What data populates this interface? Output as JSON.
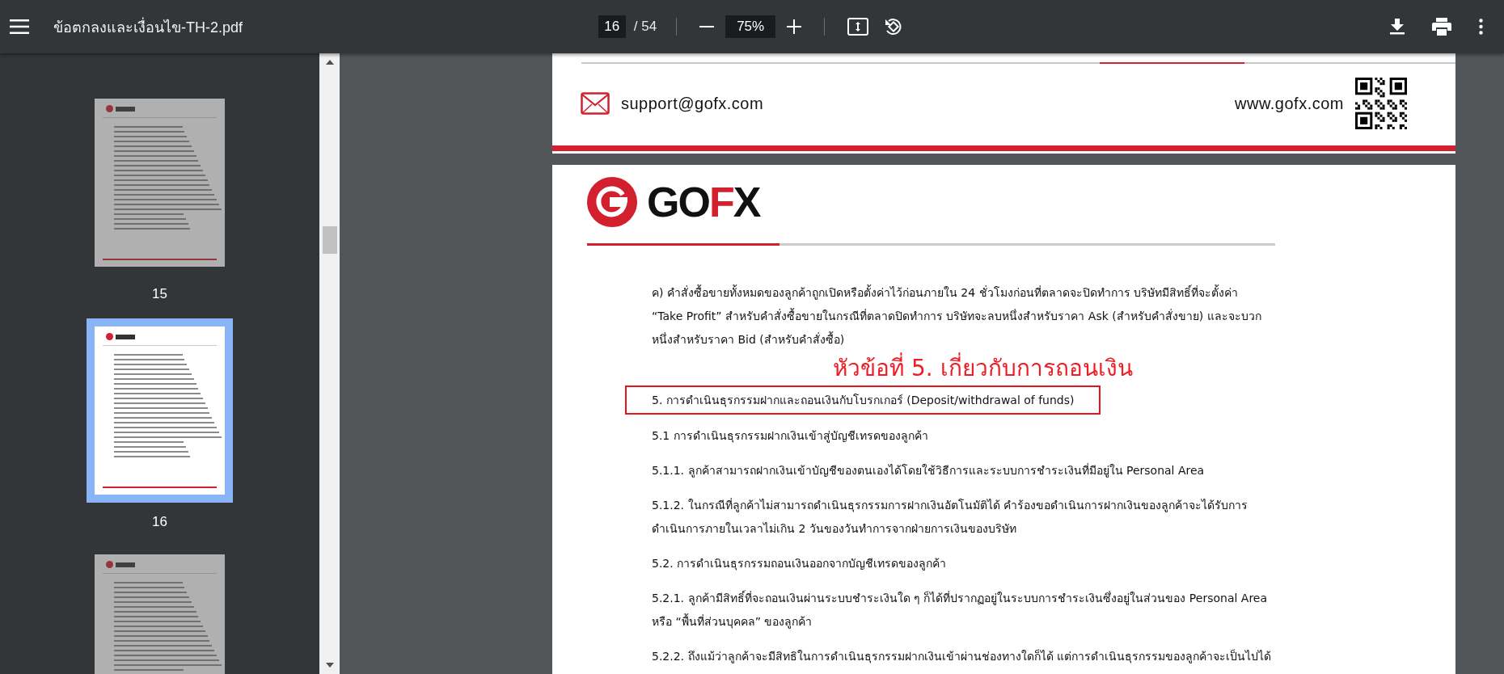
{
  "toolbar": {
    "title": "ข้อตกลงและเงื่อนไข-TH-2.pdf",
    "page_number": "16",
    "page_total": "/ 54",
    "zoom": "75%"
  },
  "sidebar": {
    "thumbnails": [
      {
        "label": "15",
        "selected": false
      },
      {
        "label": "16",
        "selected": true
      },
      {
        "selected": false
      }
    ]
  },
  "previous_page_footer": {
    "email": "support@gofx.com",
    "website": "www.gofx.com"
  },
  "page": {
    "logo": [
      {
        "text": "GO",
        "color": "#111111"
      },
      {
        "text": "F",
        "color": "#d2202f"
      },
      {
        "text": "X",
        "color": "#111111"
      }
    ],
    "annotation": "หัวข้อที่ 5. เกี่ยวกับการถอนเงิน",
    "paragraphs": [
      {
        "text": "ค) คำสั่งซื้อขายทั้งหมดของลูกค้าถูกเปิดหรือตั้งค่าไว้ก่อนภายใน 24 ชั่วโมงก่อนที่ตลาดจะปิดทำการ บริษัทมีสิทธิ์ที่จะตั้งค่า\n“Take Profit” สำหรับคำสั่งซื้อขายในกรณีที่ตลาดปิดทำการ บริษัทจะลบหนึ่งสำหรับราคา Ask (สำหรับคำสั่งขาย) และจะบวก\nหนึ่งสำหรับราคา Bid (สำหรับคำสั่งซื้อ)",
        "highlighted": false
      },
      {
        "text": "5. การดำเนินธุรกรรมฝากและถอนเงินกับโบรกเกอร์ (Deposit/withdrawal of funds)",
        "highlighted": true
      },
      {
        "text": "5.1 การดำเนินธุรกรรมฝากเงินเข้าสู่บัญชีเทรดของลูกค้า",
        "highlighted": false
      },
      {
        "text": "5.1.1. ลูกค้าสามารถฝากเงินเข้าบัญชีของตนเองได้โดยใช้วิธีการและระบบการชำระเงินที่มีอยู่ใน Personal Area",
        "highlighted": false
      },
      {
        "text": "5.1.2. ในกรณีที่ลูกค้าไม่สามารถดำเนินธุรกรรมการฝากเงินอัตโนมัติได้ คำร้องขอดำเนินการฝากเงินของลูกค้าจะได้รับการ\nดำเนินการภายในเวลาไม่เกิน 2 วันของวันทำการจากฝ่ายการเงินของบริษัท",
        "highlighted": false
      },
      {
        "text": "5.2. การดำเนินธุรกรรมถอนเงินออกจากบัญชีเทรดของลูกค้า",
        "highlighted": false
      },
      {
        "text": "5.2.1. ลูกค้ามีสิทธิ์ที่จะถอนเงินผ่านระบบชำระเงินใด ๆ ก็ได้ที่ปรากฏอยู่ในระบบการชำระเงินซึ่งอยู่ในส่วนของ Personal Area\nหรือ “พื้นที่ส่วนบุคคล” ของลูกค้า",
        "highlighted": false
      },
      {
        "text": "5.2.2. ถึงแม้ว่าลูกค้าจะมีสิทธิในการดำเนินธุรกรรมฝากเงินเข้าผ่านช่องทางใดก็ได้ แต่การดำเนินธุรกรรมของลูกค้าจะเป็นไปได้",
        "highlighted": false
      }
    ]
  }
}
